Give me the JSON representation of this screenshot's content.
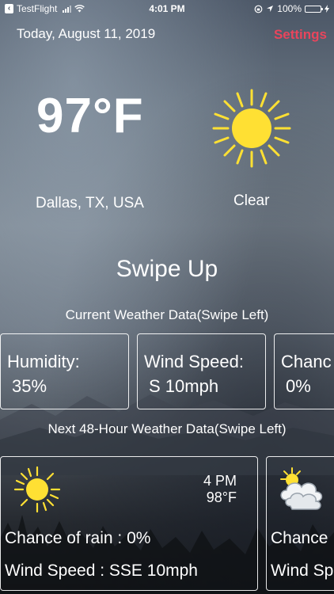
{
  "status_bar": {
    "back_app": "TestFlight",
    "time": "4:01 PM",
    "battery": "100%"
  },
  "header": {
    "date": "Today, August 11, 2019",
    "settings_label": "Settings"
  },
  "current": {
    "temperature": "97°F",
    "location": "Dallas, TX, USA",
    "condition": "Clear",
    "condition_icon": "sun-icon"
  },
  "swipe_hint": "Swipe Up",
  "current_section": {
    "title": "Current Weather Data(Swipe Left)",
    "cards": [
      {
        "label": "Humidity:",
        "value": "35%"
      },
      {
        "label": "Wind Speed:",
        "value": "S 10mph"
      },
      {
        "label": "Chanc",
        "value": "0%"
      }
    ]
  },
  "forecast_section": {
    "title": "Next 48-Hour Weather Data(Swipe Left)",
    "cards": [
      {
        "icon": "sun-icon",
        "time": "4 PM",
        "temperature": "98°F",
        "rain": "Chance of rain : 0%",
        "wind": "Wind Speed : SSE 10mph"
      },
      {
        "icon": "partly-cloudy-icon",
        "rain": "Chance",
        "wind": "Wind Sp"
      }
    ]
  },
  "colors": {
    "accent": "#e9455c",
    "sun": "#ffe033",
    "battery": "#4cd964"
  }
}
